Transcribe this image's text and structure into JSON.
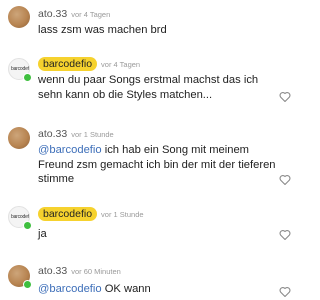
{
  "comments": [
    {
      "username": "ato.33",
      "time": "vor 4 Tagen",
      "avatar_icon": "egg-avatar-icon",
      "lines": [
        "lass zsm was machen brd"
      ],
      "mention": ""
    },
    {
      "username": "barcodefio",
      "time": "vor 4 Tagen",
      "avatar_icon": "barcodefio-logo-avatar-icon",
      "avatar_logo_text": "barcodefio",
      "lines": [
        "wenn du paar Songs erstmal machst das ich",
        "sehn kann ob die Styles matchen..."
      ],
      "mention": ""
    },
    {
      "username": "ato.33",
      "time": "vor 1 Stunde",
      "avatar_icon": "egg-avatar-icon",
      "mention": "@barcodefio",
      "lines": [
        " ich hab ein Song mit meinem",
        "Freund zsm gemacht ich bin der mit der tieferen",
        "stimme"
      ]
    },
    {
      "username": "barcodefio",
      "time": "vor 1 Stunde",
      "avatar_icon": "barcodefio-logo-avatar-icon",
      "avatar_logo_text": "barcodefio",
      "lines": [
        "ja"
      ],
      "mention": ""
    },
    {
      "username": "ato.33",
      "time": "vor 60 Minuten",
      "avatar_icon": "egg-avatar-icon",
      "mention": "@barcodefio",
      "lines": [
        " OK wann"
      ]
    }
  ],
  "colors": {
    "badge": "#f6d22e",
    "mention": "#3e6fb9",
    "online": "#3fbf3f"
  },
  "icons": {
    "like": "heart-outline-icon"
  }
}
